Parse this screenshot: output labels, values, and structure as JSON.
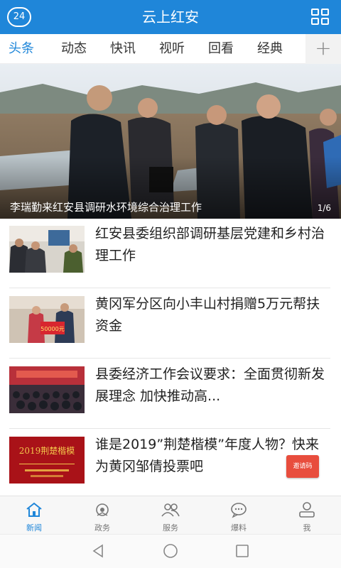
{
  "header": {
    "logo_text": "24",
    "title": "云上红安",
    "menu_icon": "grid-icon"
  },
  "tabs": [
    "头条",
    "动态",
    "快讯",
    "视听",
    "回看",
    "经典"
  ],
  "active_tab": 0,
  "hero": {
    "caption": "李瑞勤来红安县调研水环境综合治理工作",
    "pager": "1/6"
  },
  "news": [
    {
      "title": "红安县委组织部调研基层党建和乡村治理工作"
    },
    {
      "title": "黄冈军分区向小丰山村捐赠5万元帮扶资金",
      "thumb_text": "50000元"
    },
    {
      "title": "县委经济工作会议要求：全面贯彻新发展理念 加快推动高..."
    },
    {
      "title": "谁是2019”荆楚楷模”年度人物？快来为黄冈邹倩投票吧",
      "thumb_text": "2019荆楚楷模"
    }
  ],
  "floating_badge": "邀请码",
  "bottom_nav": [
    {
      "label": "新闻",
      "icon": "home-icon"
    },
    {
      "label": "政务",
      "icon": "emblem-icon"
    },
    {
      "label": "服务",
      "icon": "people-icon"
    },
    {
      "label": "爆料",
      "icon": "chat-icon"
    },
    {
      "label": "我",
      "icon": "user-icon"
    }
  ],
  "active_nav": 0,
  "colors": {
    "brand": "#1f86d9",
    "badge": "#e84d3d"
  }
}
